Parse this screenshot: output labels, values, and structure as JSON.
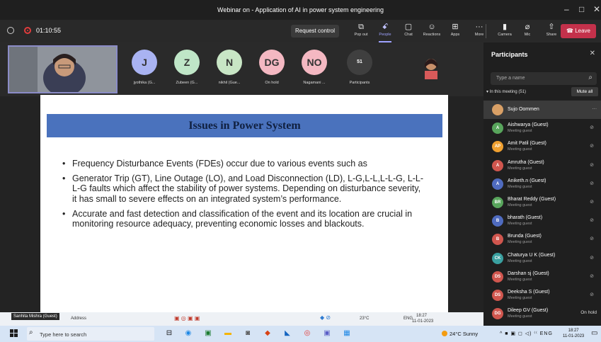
{
  "window": {
    "title": "Webinar on - Application of AI in power system engineering",
    "min": "–",
    "max": "□",
    "close": "✕"
  },
  "meeting": {
    "timer": "01:10:55",
    "request_control": "Request control",
    "leave_label": "Leave",
    "leave_icon": "☎"
  },
  "toolbar": [
    {
      "name": "pop-out",
      "icon": "⧉",
      "label": "Pop out"
    },
    {
      "name": "people",
      "icon": "ꗃ",
      "label": "People"
    },
    {
      "name": "chat",
      "icon": "▢",
      "label": "Chat"
    },
    {
      "name": "reactions",
      "icon": "☺",
      "label": "Reactions"
    },
    {
      "name": "apps",
      "icon": "⊞",
      "label": "Apps"
    },
    {
      "name": "more",
      "icon": "···",
      "label": "More"
    },
    {
      "name": "camera",
      "icon": "▮",
      "label": "Camera"
    },
    {
      "name": "mic",
      "icon": "⌀",
      "label": "Mic"
    },
    {
      "name": "share",
      "icon": "⇧",
      "label": "Share"
    }
  ],
  "strip_tiles": [
    {
      "initials": "J",
      "name": "jyothika (G...",
      "color": "#a9b3f2"
    },
    {
      "initials": "Z",
      "name": "Zubeen (G...",
      "color": "#bfe6c7"
    },
    {
      "initials": "N",
      "name": "nikhil (Gue...",
      "color": "#c8e6c5"
    },
    {
      "initials": "DG",
      "name": "On hold",
      "color": "#f4b8c2"
    },
    {
      "initials": "NO",
      "name": "Nagamani ...",
      "color": "#f4b8c2"
    },
    {
      "initials": "51",
      "name": "Participants",
      "color": "#3f3f3f"
    }
  ],
  "slide": {
    "title": "Issues in Power System",
    "bullets": [
      "Frequency Disturbance Events (FDEs) occur due to various events such as",
      "Generator Trip (GT), Line Outage (LO), and Load Disconnection (LD), L-G,L-L,L-L-G, L-L-L-G faults which affect the stability of power systems. Depending on disturbance severity, it has small to severe effects on an integrated system’s performance.",
      "Accurate and fast detection and classification of the event and its location are crucial in monitoring resource adequacy, preventing economic losses and  blackouts."
    ]
  },
  "presenter_label": "Sanhita Mishra (Guest)",
  "inner_taskbar": {
    "address": "Address",
    "weather": "23°C",
    "lang": "ENG",
    "time": "18:27",
    "date": "11-01-2023"
  },
  "participants": {
    "title": "Participants",
    "search_placeholder": "Type a name",
    "section": "In this meeting (51)",
    "mute_all": "Mute all",
    "list": [
      {
        "initials": "",
        "name": "Sujo Oommen",
        "role": "",
        "color": "#d9a066",
        "status": "···"
      },
      {
        "initials": "A",
        "name": "Aishwarya (Guest)",
        "role": "Meeting guest",
        "color": "#58a55c",
        "status": "⊘"
      },
      {
        "initials": "AP",
        "name": "Amit Patil (Guest)",
        "role": "Meeting guest",
        "color": "#f0a030",
        "status": "⊘"
      },
      {
        "initials": "A",
        "name": "Amrutha (Guest)",
        "role": "Meeting guest",
        "color": "#d0564e",
        "status": "⊘"
      },
      {
        "initials": "A",
        "name": "Aniketh.n (Guest)",
        "role": "Meeting guest",
        "color": "#4f6bbf",
        "status": "⊘"
      },
      {
        "initials": "BR",
        "name": "Bharat Reddy (Guest)",
        "role": "Meeting guest",
        "color": "#58a55c",
        "status": "⊘"
      },
      {
        "initials": "B",
        "name": "bharath (Guest)",
        "role": "Meeting guest",
        "color": "#4f6bbf",
        "status": "⊘"
      },
      {
        "initials": "B",
        "name": "Brunda (Guest)",
        "role": "Meeting guest",
        "color": "#d0564e",
        "status": "⊘"
      },
      {
        "initials": "CK",
        "name": "Chaturya U K (Guest)",
        "role": "Meeting guest",
        "color": "#3aa0a0",
        "status": "⊘"
      },
      {
        "initials": "DS",
        "name": "Darshan sj (Guest)",
        "role": "Meeting guest",
        "color": "#d0564e",
        "status": "⊘"
      },
      {
        "initials": "DS",
        "name": "Deeksha S (Guest)",
        "role": "Meeting guest",
        "color": "#d0564e",
        "status": "⊘"
      },
      {
        "initials": "DG",
        "name": "Dileep GV (Guest)",
        "role": "Meeting guest",
        "color": "#d0564e",
        "status": "On hold"
      }
    ]
  },
  "taskbar": {
    "search_placeholder": "Type here to search",
    "weather": "24°C  Sunny",
    "tray": "^ ■ ▣ ◻ ◁) ⁽⁽ ENG",
    "time": "18:27",
    "date": "11-01-2023"
  },
  "colors": {
    "accent": "#9ea2ff",
    "leave": "#c4314b",
    "banner": "#4a72bd"
  }
}
